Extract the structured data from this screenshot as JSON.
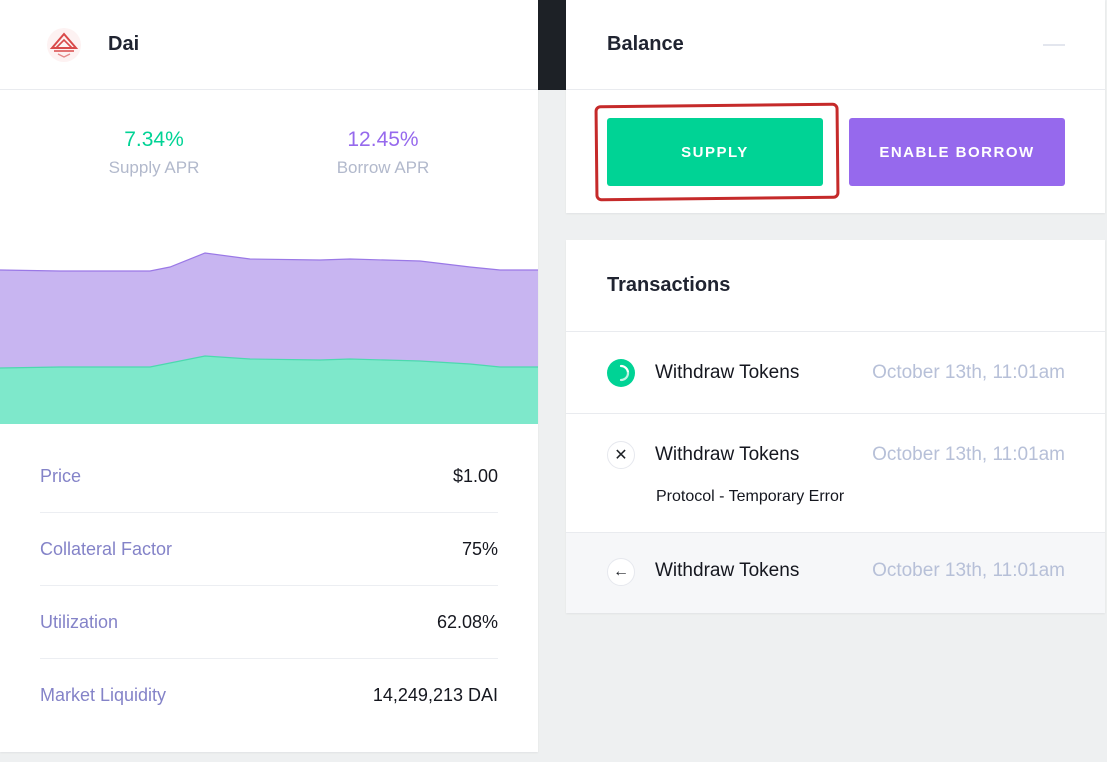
{
  "market": {
    "name": "Dai",
    "logo_icon": "dai-logo-icon",
    "supply_apr": "7.34%",
    "supply_apr_label": "Supply APR",
    "borrow_apr": "12.45%",
    "borrow_apr_label": "Borrow APR",
    "stats": [
      {
        "label": "Price",
        "value": "$1.00"
      },
      {
        "label": "Collateral Factor",
        "value": "75%"
      },
      {
        "label": "Utilization",
        "value": "62.08%"
      },
      {
        "label": "Market Liquidity",
        "value": "14,249,213 DAI"
      }
    ]
  },
  "balance": {
    "title": "Balance",
    "supply_button": "SUPPLY",
    "enable_borrow_button": "ENABLE BORROW"
  },
  "transactions": {
    "title": "Transactions",
    "items": [
      {
        "status_icon": "pending-spinner-icon",
        "name": "Withdraw Tokens",
        "date": "October 13th, 11:01am",
        "error": ""
      },
      {
        "status_icon": "close-icon",
        "name": "Withdraw Tokens",
        "date": "October 13th, 11:01am",
        "error": "Protocol - Temporary Error"
      },
      {
        "status_icon": "arrow-left-icon",
        "name": "Withdraw Tokens",
        "date": "October 13th, 11:01am",
        "error": ""
      }
    ]
  },
  "colors": {
    "supply": "#00d395",
    "borrow": "#9669ed",
    "annotation": "#c52a2a"
  }
}
